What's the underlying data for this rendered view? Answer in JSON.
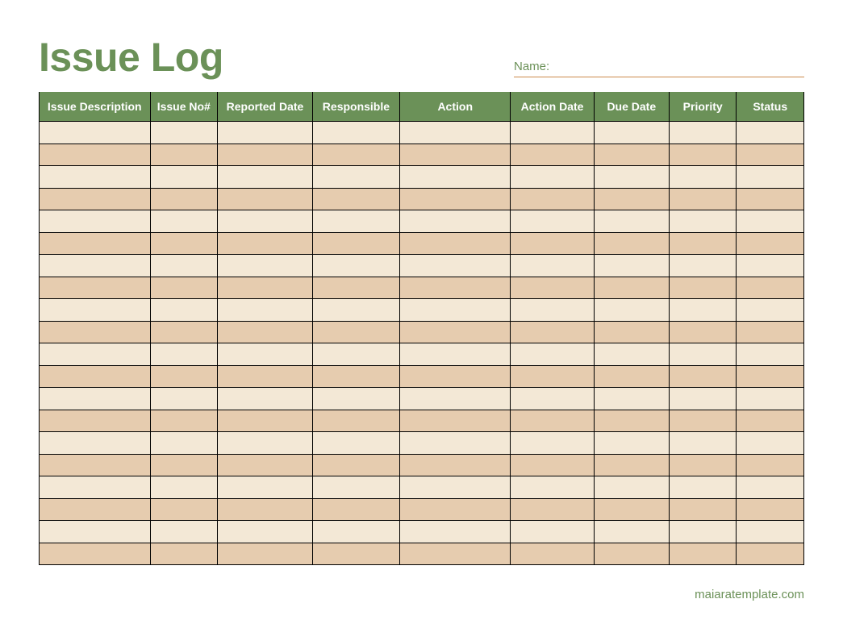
{
  "title": "Issue Log",
  "name_field": {
    "label": "Name:",
    "value": ""
  },
  "table": {
    "headers": [
      "Issue Description",
      "Issue No#",
      "Reported Date",
      "Responsible",
      "Action",
      "Action Date",
      "Due Date",
      "Priority",
      "Status"
    ],
    "rows": [
      [
        "",
        "",
        "",
        "",
        "",
        "",
        "",
        "",
        ""
      ],
      [
        "",
        "",
        "",
        "",
        "",
        "",
        "",
        "",
        ""
      ],
      [
        "",
        "",
        "",
        "",
        "",
        "",
        "",
        "",
        ""
      ],
      [
        "",
        "",
        "",
        "",
        "",
        "",
        "",
        "",
        ""
      ],
      [
        "",
        "",
        "",
        "",
        "",
        "",
        "",
        "",
        ""
      ],
      [
        "",
        "",
        "",
        "",
        "",
        "",
        "",
        "",
        ""
      ],
      [
        "",
        "",
        "",
        "",
        "",
        "",
        "",
        "",
        ""
      ],
      [
        "",
        "",
        "",
        "",
        "",
        "",
        "",
        "",
        ""
      ],
      [
        "",
        "",
        "",
        "",
        "",
        "",
        "",
        "",
        ""
      ],
      [
        "",
        "",
        "",
        "",
        "",
        "",
        "",
        "",
        ""
      ],
      [
        "",
        "",
        "",
        "",
        "",
        "",
        "",
        "",
        ""
      ],
      [
        "",
        "",
        "",
        "",
        "",
        "",
        "",
        "",
        ""
      ],
      [
        "",
        "",
        "",
        "",
        "",
        "",
        "",
        "",
        ""
      ],
      [
        "",
        "",
        "",
        "",
        "",
        "",
        "",
        "",
        ""
      ],
      [
        "",
        "",
        "",
        "",
        "",
        "",
        "",
        "",
        ""
      ],
      [
        "",
        "",
        "",
        "",
        "",
        "",
        "",
        "",
        ""
      ],
      [
        "",
        "",
        "",
        "",
        "",
        "",
        "",
        "",
        ""
      ],
      [
        "",
        "",
        "",
        "",
        "",
        "",
        "",
        "",
        ""
      ],
      [
        "",
        "",
        "",
        "",
        "",
        "",
        "",
        "",
        ""
      ],
      [
        "",
        "",
        "",
        "",
        "",
        "",
        "",
        "",
        ""
      ]
    ]
  },
  "footer": "maiaratemplate.com"
}
